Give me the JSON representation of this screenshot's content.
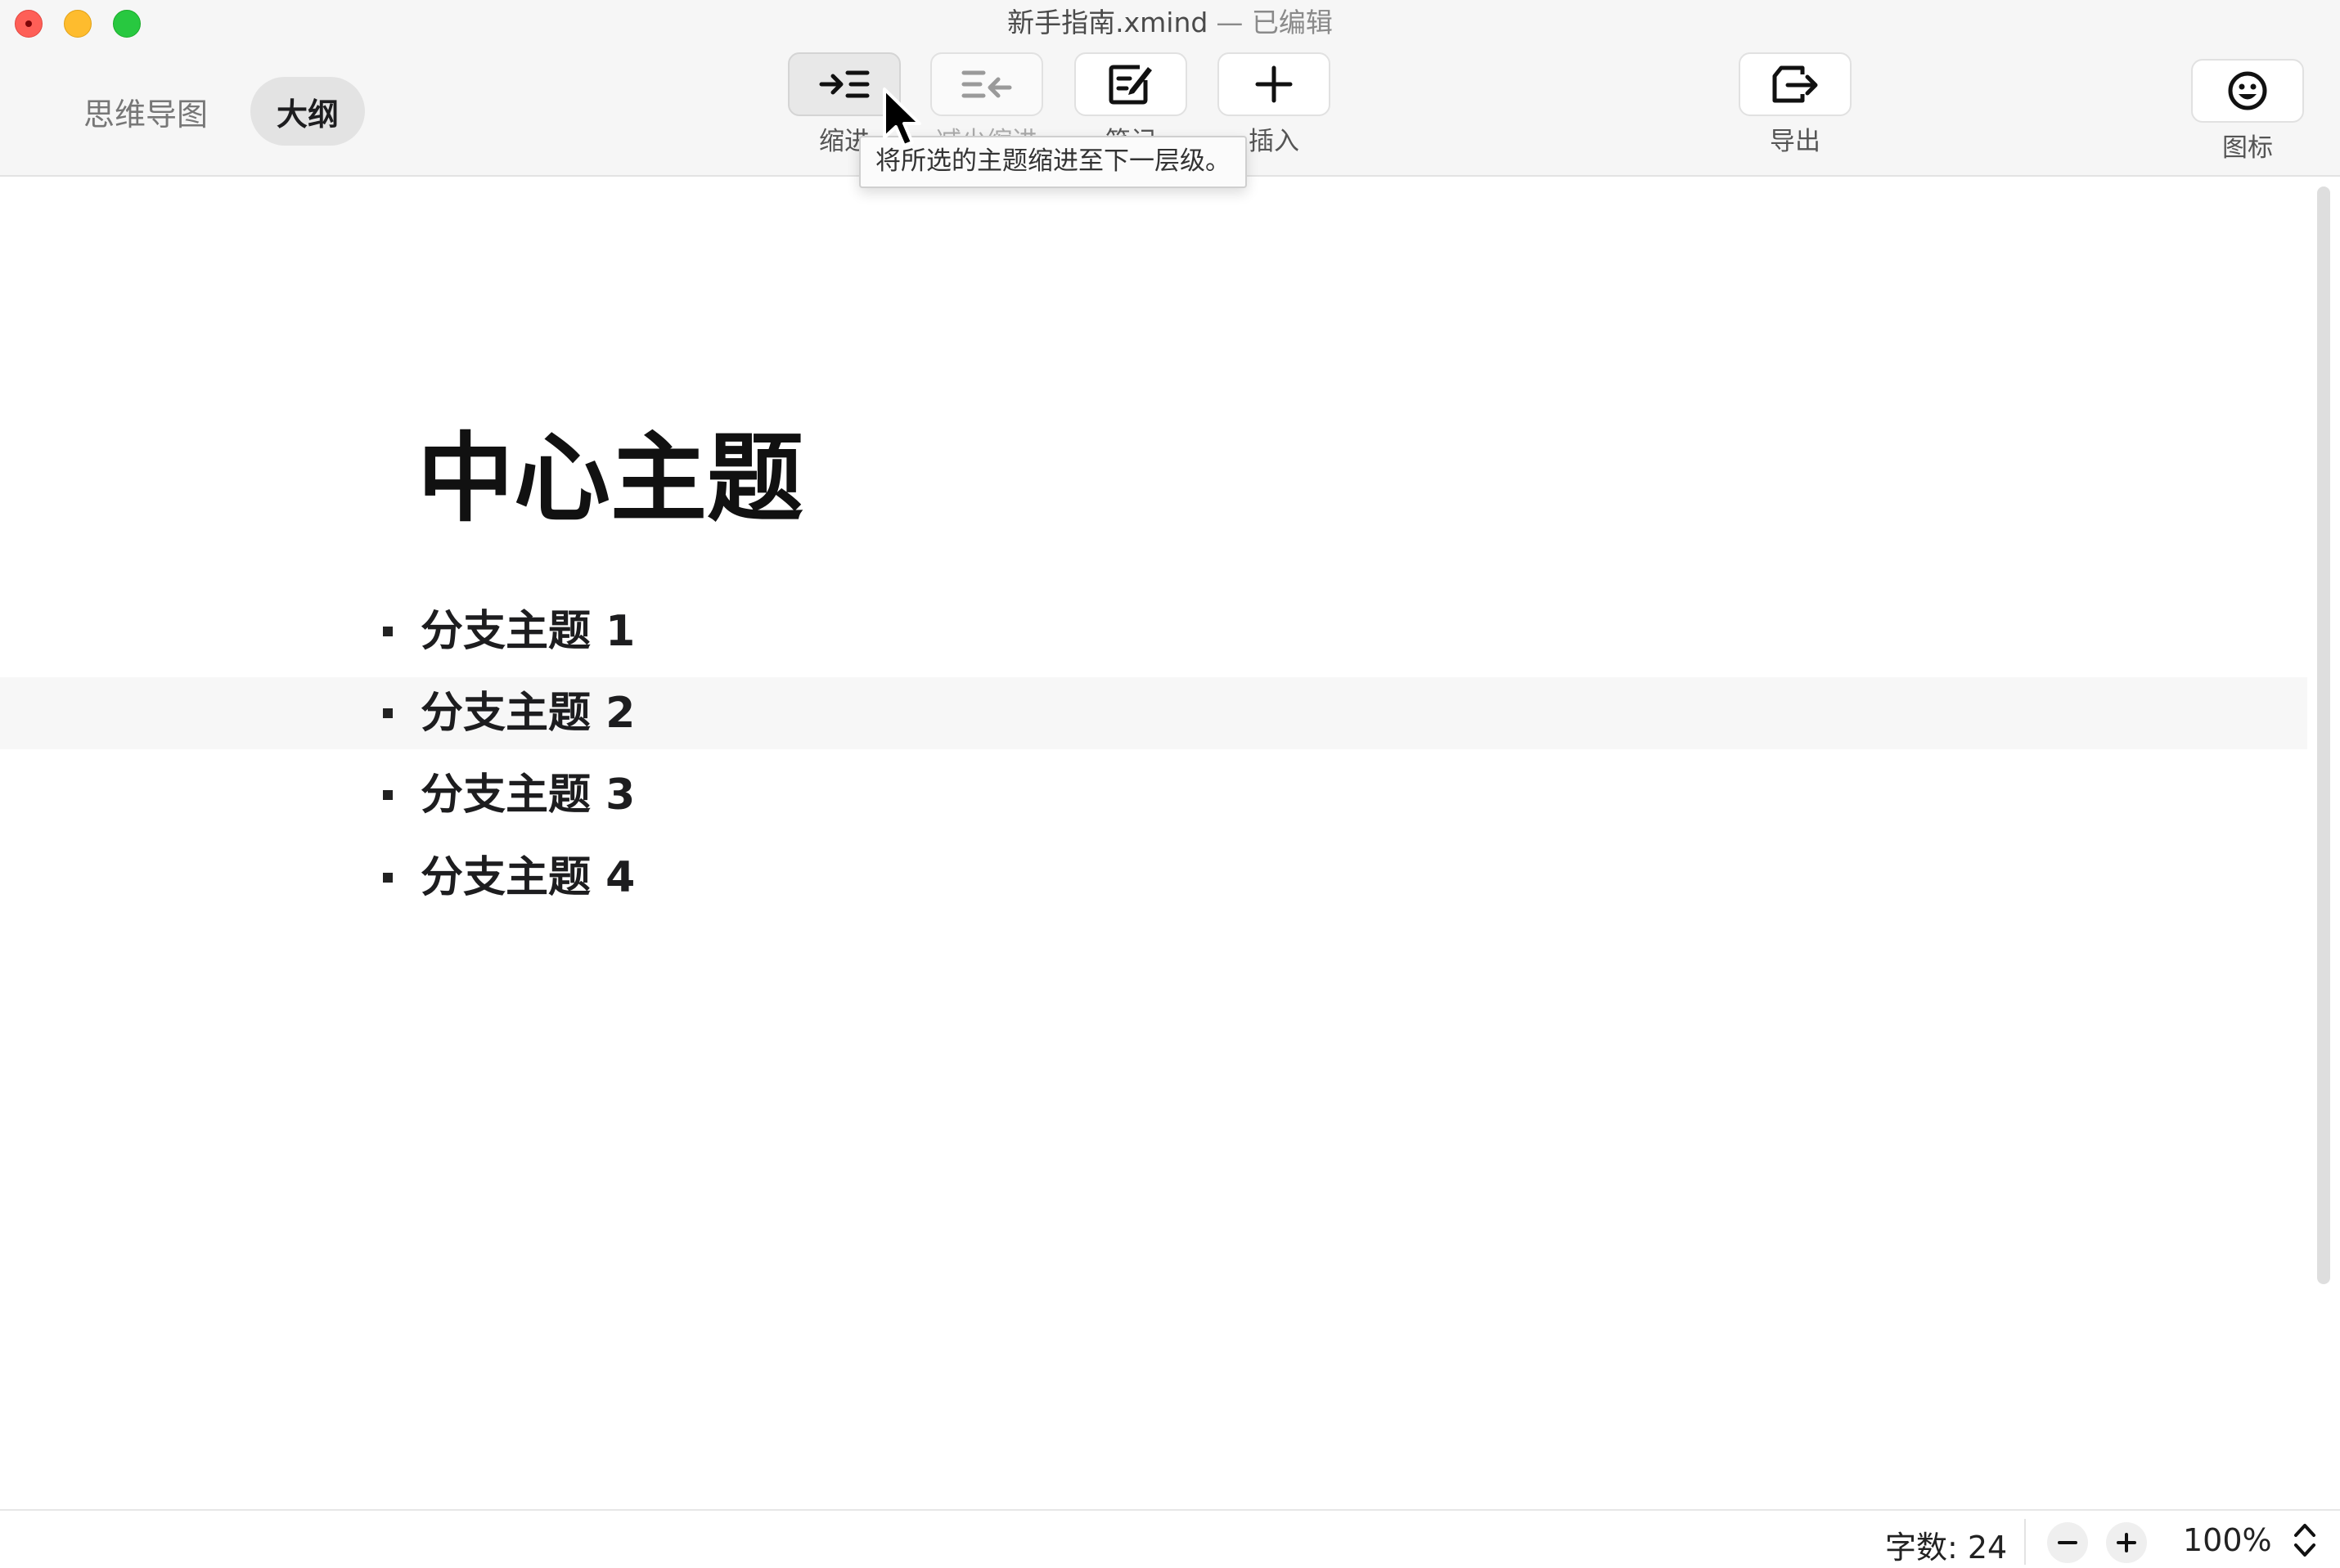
{
  "window": {
    "title": "新手指南.xmind",
    "edited": "— 已编辑"
  },
  "view_tabs": [
    {
      "label": "思维导图",
      "active": false
    },
    {
      "label": "大纲",
      "active": true
    }
  ],
  "toolbar": {
    "indent": {
      "label": "缩进",
      "icon": "indent-icon",
      "state": "pressed"
    },
    "outdent": {
      "label": "减少缩进",
      "icon": "outdent-icon",
      "state": "disabled"
    },
    "note": {
      "label": "笔记",
      "icon": "note-edit-icon"
    },
    "insert": {
      "label": "插入",
      "icon": "plus-icon"
    },
    "export": {
      "label": "导出",
      "icon": "export-icon"
    },
    "icons": {
      "label": "图标",
      "icon": "smiley-icon"
    }
  },
  "tooltip": {
    "text": "将所选的主题缩进至下一层级。"
  },
  "outline": {
    "central_topic": "中心主题",
    "branches": [
      {
        "label": "分支主题 1"
      },
      {
        "label": "分支主题 2",
        "hovered": true
      },
      {
        "label": "分支主题 3"
      },
      {
        "label": "分支主题 4"
      }
    ]
  },
  "status": {
    "word_count": "字数: 24",
    "zoom": "100%"
  },
  "colors": {
    "toolbar_bg": "#f6f6f6",
    "active_tab_bg": "#e3e3e3",
    "close": "#fe5f57",
    "minimize": "#febc2e",
    "maximize": "#28c840"
  }
}
